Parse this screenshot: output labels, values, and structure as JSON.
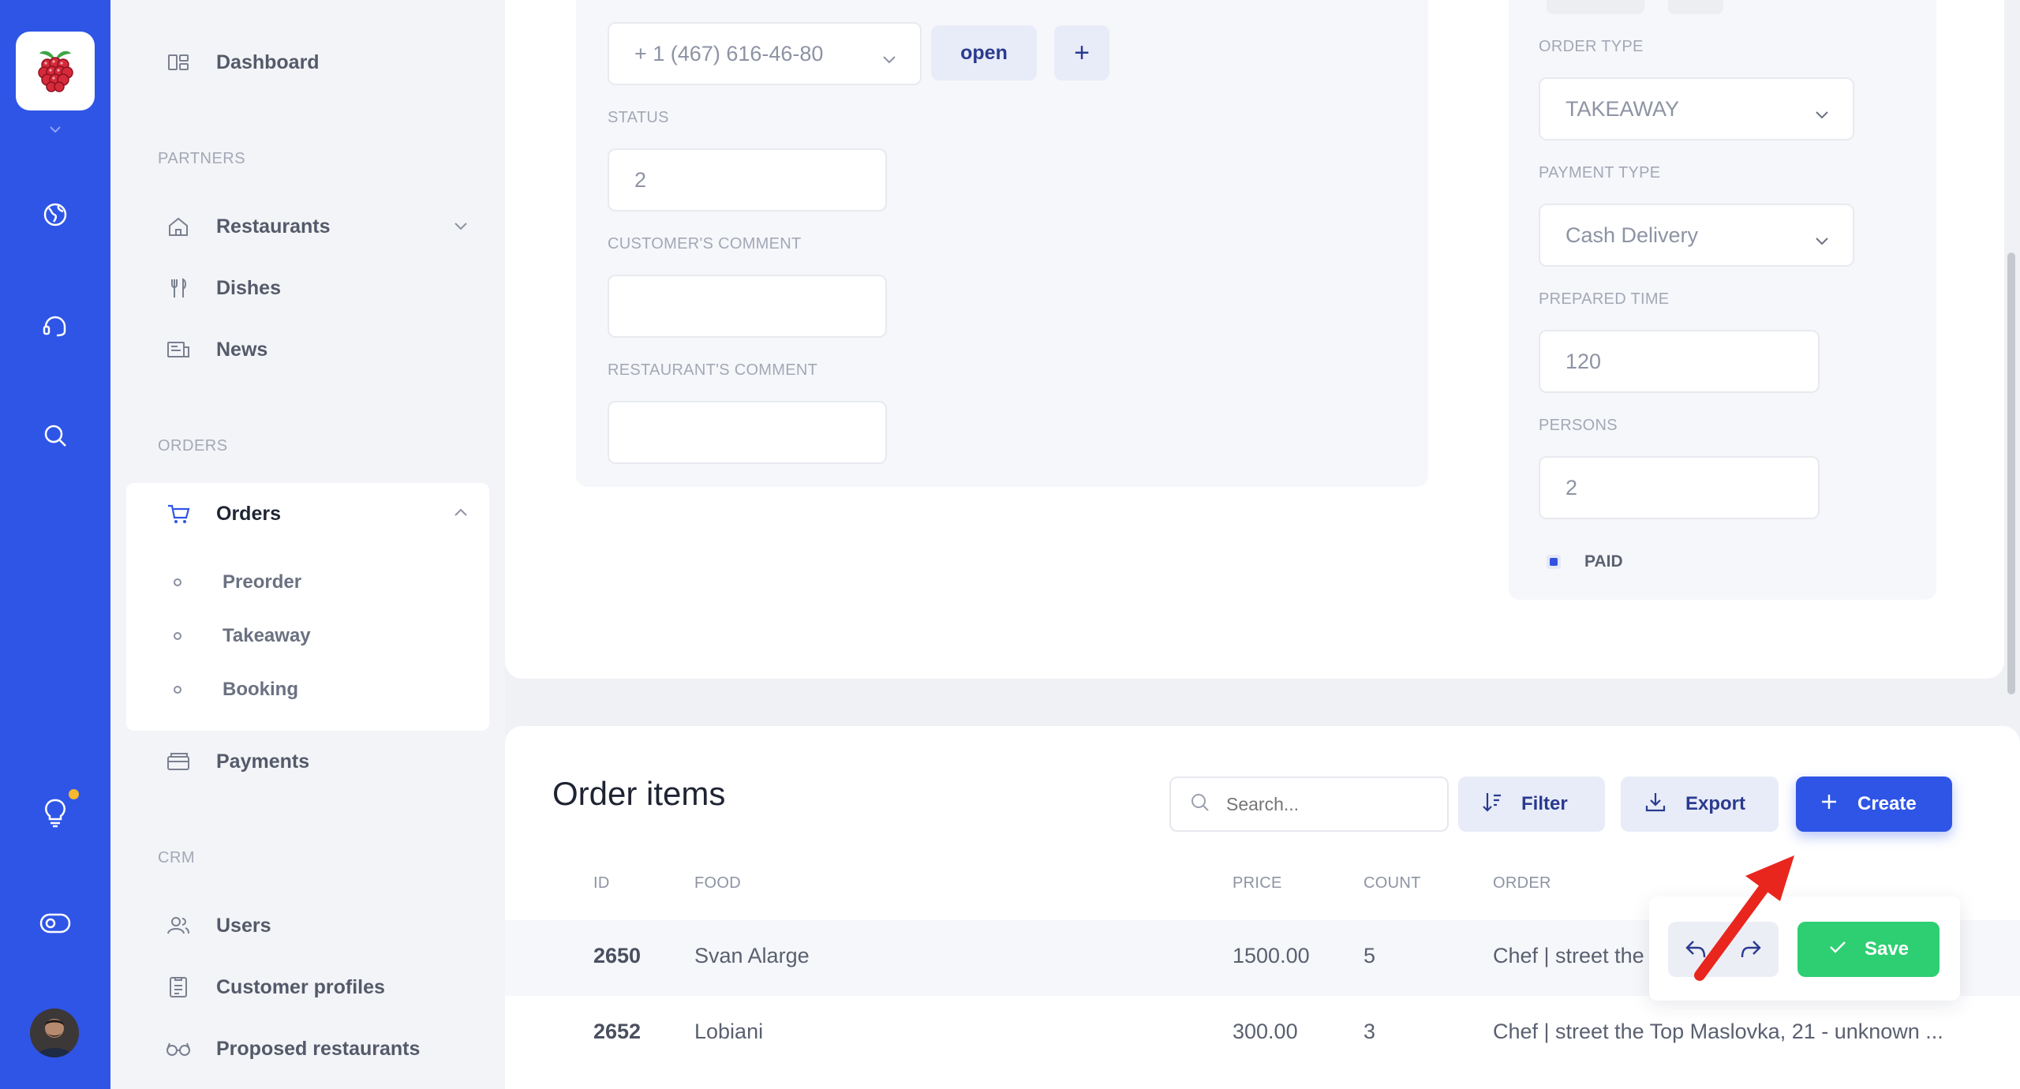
{
  "app": {
    "brand_color": "#2f55e6"
  },
  "rail": {
    "icons": [
      "raspberry-logo-icon",
      "chevron-down-icon",
      "globe-icon",
      "support-chat-icon",
      "search-icon",
      "lightbulb-icon",
      "toggle-icon"
    ],
    "notification_dot_color": "#f7b92b"
  },
  "sidebar": {
    "dashboard": "Dashboard",
    "sections": {
      "partners": "PARTNERS",
      "orders": "ORDERS",
      "crm": "CRM"
    },
    "restaurants": "Restaurants",
    "dishes": "Dishes",
    "news": "News",
    "orders": "Orders",
    "sub_orders": [
      "Preorder",
      "Takeaway",
      "Booking"
    ],
    "payments": "Payments",
    "users": "Users",
    "customer_profiles": "Customer profiles",
    "proposed_restaurants": "Proposed restaurants"
  },
  "form": {
    "phone": "+ 1 (467) 616-46-80",
    "open_label": "open",
    "add_label": "+",
    "status_label": "STATUS",
    "status_value": "2",
    "customer_comment_label": "CUSTOMER'S COMMENT",
    "customer_comment_value": "",
    "restaurant_comment_label": "RESTAURANT'S COMMENT",
    "restaurant_comment_value": "",
    "order_type_label": "ORDER TYPE",
    "order_type_value": "TAKEAWAY",
    "payment_type_label": "PAYMENT TYPE",
    "payment_type_value": "Cash Delivery",
    "prepared_time_label": "PREPARED TIME",
    "prepared_time_value": "120",
    "persons_label": "PERSONS",
    "persons_value": "2",
    "paid_label": "PAID",
    "paid_checked": true
  },
  "order_items": {
    "title": "Order items",
    "search_placeholder": "Search...",
    "filter_label": "Filter",
    "export_label": "Export",
    "create_label": "Create",
    "columns": {
      "id": "ID",
      "food": "FOOD",
      "price": "PRICE",
      "count": "COUNT",
      "order": "ORDER"
    },
    "rows": [
      {
        "id": "2650",
        "food": "Svan Alarge",
        "price": "1500.00",
        "count": "5",
        "order": "Chef | street the"
      },
      {
        "id": "2652",
        "food": "Lobiani",
        "price": "300.00",
        "count": "3",
        "order": "Chef | street the Top Maslovka, 21 - unknown ..."
      }
    ]
  },
  "toolbar": {
    "save_label": "Save",
    "save_color": "#2ecf72"
  }
}
